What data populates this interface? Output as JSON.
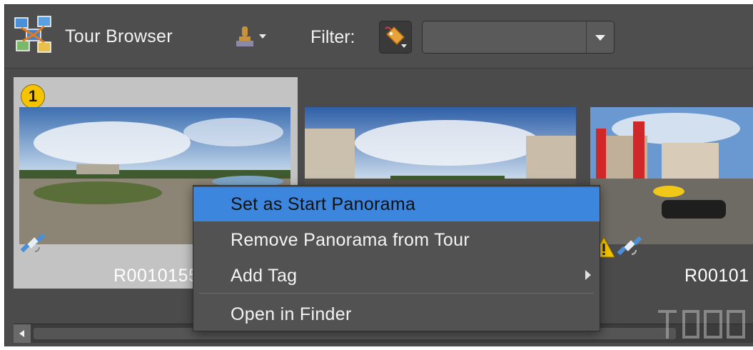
{
  "app": {
    "title": "Tour Browser",
    "icon": "tour-browser-logo"
  },
  "toolbar": {
    "stamp_icon": "stamp-icon",
    "filter_label": "Filter:",
    "tag_icon": "tag-icon",
    "filter_value": ""
  },
  "tiles": [
    {
      "caption": "R0010155",
      "start_badge": "1",
      "selected": true,
      "gps": true,
      "warning": false
    },
    {
      "caption": "",
      "selected": false,
      "gps": false,
      "warning": false
    },
    {
      "caption": "R00101",
      "selected": false,
      "gps": true,
      "warning": true
    }
  ],
  "context_menu": {
    "items": [
      {
        "label": "Set as Start Panorama",
        "active": true
      },
      {
        "label": "Remove Panorama from Tour",
        "active": false
      },
      {
        "label": "Add Tag",
        "active": false,
        "submenu": true
      },
      {
        "label": "Open in Finder",
        "active": false
      }
    ]
  },
  "colors": {
    "menu_highlight": "#3d86dd",
    "toolbar_bg": "#4e4e4e",
    "selected_tile": "#c3c3c3"
  }
}
